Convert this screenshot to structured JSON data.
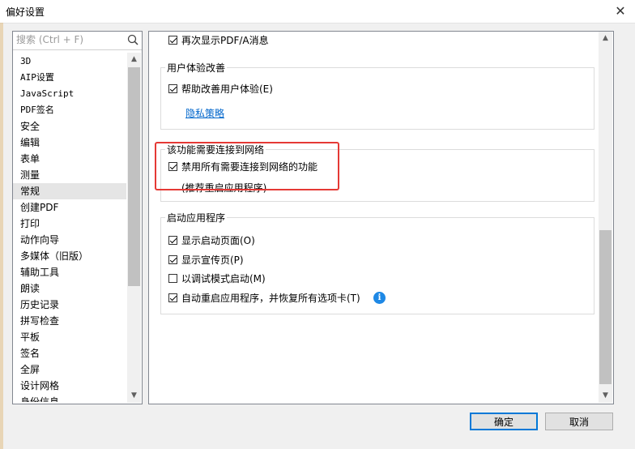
{
  "window": {
    "title": "偏好设置",
    "close_glyph": "✕"
  },
  "search": {
    "placeholder": "搜索 (Ctrl + F)"
  },
  "categories": [
    {
      "label": "3D"
    },
    {
      "label": "AIP设置"
    },
    {
      "label": "JavaScript"
    },
    {
      "label": "PDF签名"
    },
    {
      "label": "安全"
    },
    {
      "label": "编辑"
    },
    {
      "label": "表单"
    },
    {
      "label": "测量"
    },
    {
      "label": "常规",
      "selected": true
    },
    {
      "label": "创建PDF"
    },
    {
      "label": "打印"
    },
    {
      "label": "动作向导"
    },
    {
      "label": "多媒体（旧版）"
    },
    {
      "label": "辅助工具"
    },
    {
      "label": "朗读"
    },
    {
      "label": "历史记录"
    },
    {
      "label": "拼写检查"
    },
    {
      "label": "平板"
    },
    {
      "label": "签名"
    },
    {
      "label": "全屏"
    },
    {
      "label": "设计网格"
    },
    {
      "label": "身份信息"
    }
  ],
  "settings": {
    "top_option": {
      "label": "再次显示PDF/A消息",
      "checked": true
    },
    "ux_group": {
      "title": "用户体验改善",
      "help_improve": {
        "label": "帮助改善用户体验(E)",
        "checked": true
      },
      "privacy_link": "隐私策略"
    },
    "network_group": {
      "title": "该功能需要连接到网络",
      "disable_network": {
        "label": "禁用所有需要连接到网络的功能",
        "checked": true
      },
      "note": "(推荐重启应用程序)"
    },
    "startup_group": {
      "title": "启动应用程序",
      "show_startup": {
        "label": "显示启动页面(O)",
        "checked": true
      },
      "show_promo": {
        "label": "显示宣传页(P)",
        "checked": true
      },
      "debug_mode": {
        "label": "以调试模式启动(M)",
        "checked": false
      },
      "auto_restart": {
        "label": "自动重启应用程序，并恢复所有选项卡(T)",
        "checked": true
      },
      "info_glyph": "i"
    }
  },
  "buttons": {
    "ok": "确定",
    "cancel": "取消"
  },
  "colors": {
    "accent": "#0078d7",
    "highlight": "#e53935",
    "link": "#0066cc",
    "info": "#1e88e5"
  }
}
